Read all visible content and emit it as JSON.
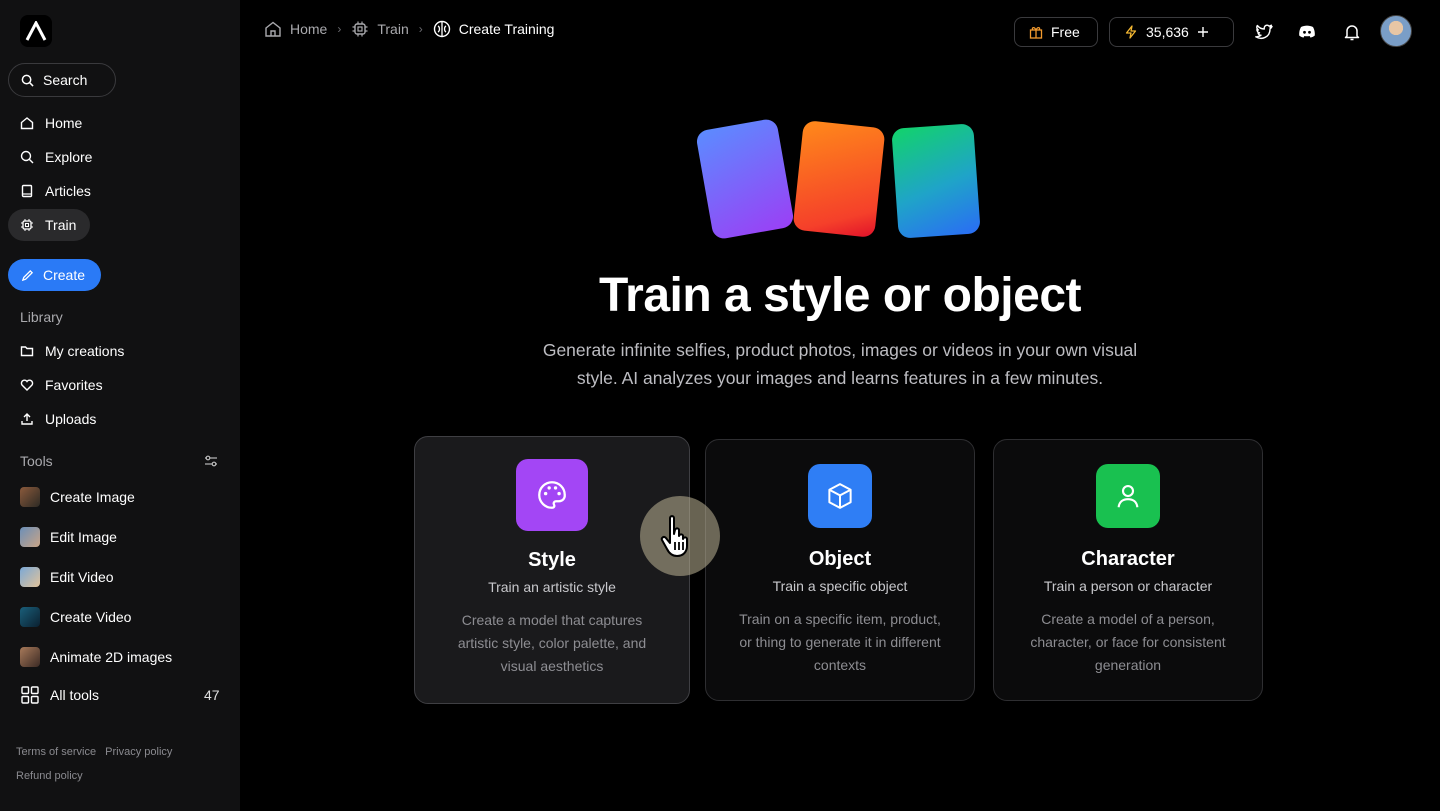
{
  "sidebar": {
    "search_label": "Search",
    "nav": [
      {
        "label": "Home",
        "icon": "home-icon"
      },
      {
        "label": "Explore",
        "icon": "search-icon"
      },
      {
        "label": "Articles",
        "icon": "book-icon"
      },
      {
        "label": "Train",
        "icon": "chip-icon",
        "active": true
      }
    ],
    "create_label": "Create",
    "library_label": "Library",
    "library": [
      {
        "label": "My creations",
        "icon": "folder-icon"
      },
      {
        "label": "Favorites",
        "icon": "heart-icon"
      },
      {
        "label": "Uploads",
        "icon": "upload-icon"
      }
    ],
    "tools_label": "Tools",
    "tools": [
      {
        "label": "Create Image"
      },
      {
        "label": "Edit Image"
      },
      {
        "label": "Edit Video"
      },
      {
        "label": "Create Video"
      },
      {
        "label": "Animate 2D images"
      }
    ],
    "all_tools_label": "All tools",
    "all_tools_count": "47",
    "footer": {
      "terms": "Terms of service",
      "privacy": "Privacy policy",
      "refund": "Refund policy"
    }
  },
  "header": {
    "breadcrumb": [
      {
        "label": "Home",
        "icon": "home-icon"
      },
      {
        "label": "Train",
        "icon": "chip-icon"
      },
      {
        "label": "Create Training",
        "icon": "brain-icon"
      }
    ],
    "plan_label": "Free",
    "credits": "35,636",
    "icons": [
      "twitter-icon",
      "discord-icon",
      "bell-icon"
    ]
  },
  "hero": {
    "title": "Train a style or object",
    "subtitle": "Generate infinite selfies, product photos, images or videos in your own visual style. AI analyzes your images and learns features in a few minutes."
  },
  "options": [
    {
      "title": "Style",
      "subtitle": "Train an artistic style",
      "description": "Create a model that captures artistic style, color palette, and visual aesthetics",
      "color": "#a346f5",
      "icon": "palette-icon"
    },
    {
      "title": "Object",
      "subtitle": "Train a specific object",
      "description": "Train on a specific item, product, or thing to generate it in different contexts",
      "color": "#2f7ef5",
      "icon": "cube-icon"
    },
    {
      "title": "Character",
      "subtitle": "Train a person or character",
      "description": "Create a model of a person, character, or face for consistent generation",
      "color": "#19c150",
      "icon": "user-icon"
    }
  ],
  "colors": {
    "accent": "#2a7af6",
    "background": "#000000",
    "sidebar": "#111112"
  }
}
